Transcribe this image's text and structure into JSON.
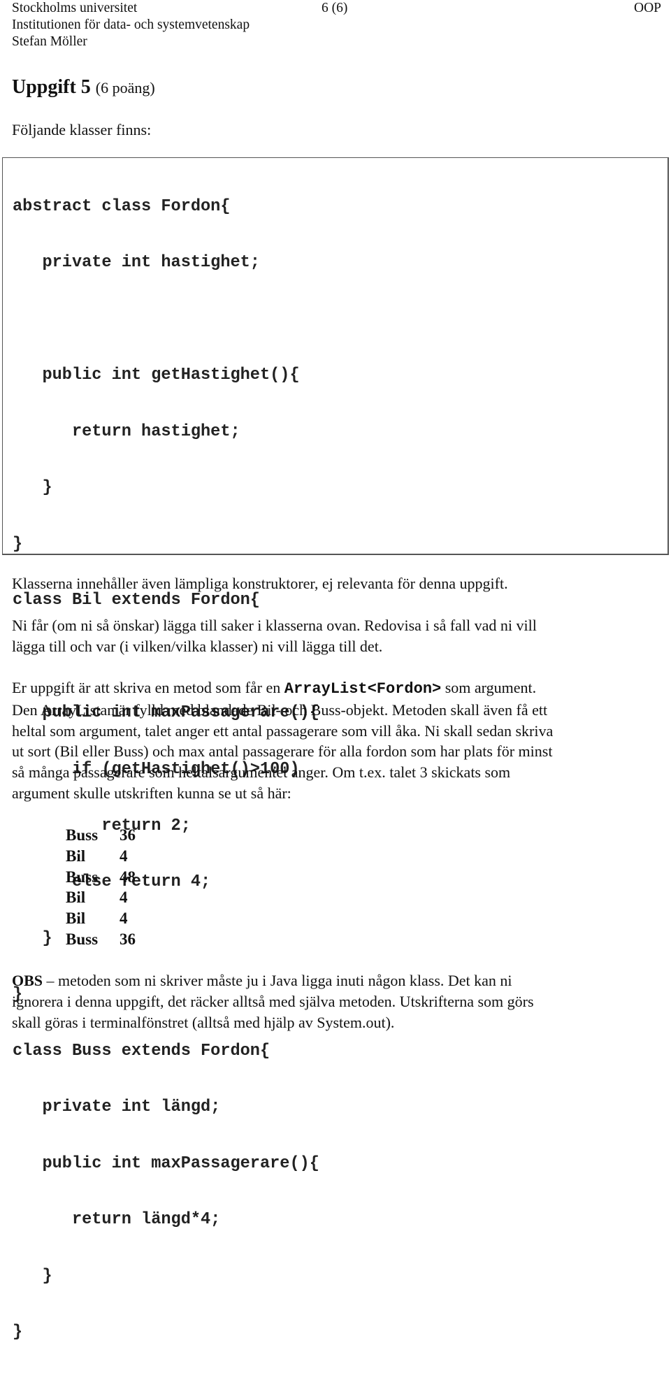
{
  "header": {
    "left_lines": [
      "Stockholms universitet",
      "Institutionen för data- och systemvetenskap",
      "Stefan Möller"
    ],
    "page": "6 (6)",
    "course": "OOP"
  },
  "task": {
    "title": "Uppgift 5",
    "points": "(6 poäng)",
    "intro": "Följande klasser finns:"
  },
  "code_lines": [
    "abstract class Fordon{",
    "   private int hastighet;",
    "",
    "   public int getHastighet(){",
    "      return hastighet;",
    "   }",
    "}",
    "class Bil extends Fordon{",
    "",
    "   public int maxPassagerare(){",
    "      if (getHastighet()>100)",
    "         return 2;",
    "      else return 4;",
    "   }",
    "}",
    "class Buss extends Fordon{",
    "   private int längd;",
    "   public int maxPassagerare(){",
    "      return längd*4;",
    "   }",
    "}"
  ],
  "paragraphs": {
    "p1": [
      "Klasserna innehåller även lämpliga konstruktorer, ej relevanta för denna uppgift."
    ],
    "p2": [
      "Ni får (om ni så önskar) lägga till saker i klasserna ovan. Redovisa i så fall vad ni vill",
      "lägga till och var (i vilken/vilka klasser) ni vill lägga till det."
    ],
    "p3_first_before": "Er uppgift är att skriva en metod som får en ",
    "p3_first_code": "ArrayList<Fordon>",
    "p3_first_after": " som argument.",
    "p3_rest": [
      "Den ArrayListan är fylld med blandade Bil- och Buss-objekt. Metoden skall även få ett",
      "heltal som argument, talet anger ett antal passagerare som vill åka. Ni skall sedan skriva",
      "ut sort (Bil eller Buss) och max antal passagerare för alla fordon som har plats för minst",
      "så många passagerare som heltalsargumentet anger. Om t.ex. talet 3 skickats som",
      "argument skulle utskriften kunna se ut så här:"
    ]
  },
  "example_output": [
    {
      "kind": "Buss",
      "count": "36"
    },
    {
      "kind": "Bil",
      "count": "4"
    },
    {
      "kind": "Buss",
      "count": "48"
    },
    {
      "kind": "Bil",
      "count": "4"
    },
    {
      "kind": "Bil",
      "count": "4"
    },
    {
      "kind": "Buss",
      "count": "36"
    }
  ],
  "obs": {
    "label": "OBS",
    "first_rest": " – metoden som ni skriver måste ju i Java ligga inuti någon klass. Det kan ni",
    "lines": [
      "ignorera i denna uppgift, det räcker alltså med själva metoden. Utskrifterna som görs",
      "skall göras i terminalfönstret (alltså med hjälp av System.out)."
    ]
  }
}
